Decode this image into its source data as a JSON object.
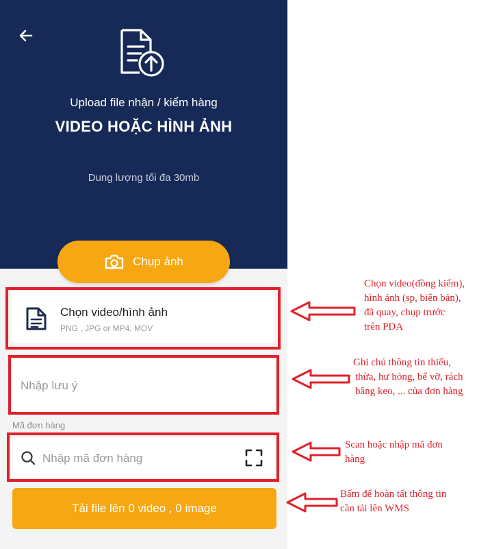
{
  "header": {
    "subtitle": "Upload file nhận / kiểm hàng",
    "title": "VIDEO HOẶC HÌNH ẢNH",
    "size_note": "Dung lượng tối đa 30mb",
    "background_color": "#172a57"
  },
  "camera_button": {
    "label": "Chụp ảnh",
    "icon": "camera-icon"
  },
  "file_picker": {
    "label": "Chọn video/hình ảnh",
    "hint": "PNG , JPG or MP4, MOV",
    "icon": "document-icon"
  },
  "note_field": {
    "placeholder": "Nhập lưu ý",
    "value": ""
  },
  "order_code": {
    "label": "Mã đơn hàng",
    "placeholder": "Nhập mã đơn hàng",
    "value": "",
    "search_icon": "search-icon",
    "scan_icon": "scan-icon"
  },
  "submit_button": {
    "label": "Tải file lên 0 video , 0 image"
  },
  "annotations": {
    "file_picker": [
      "Chọn video(đồng kiểm),",
      "hình ảnh (sp, biên bản),",
      "đã quay, chụp trước",
      "trên PDA"
    ],
    "note": [
      "Ghi chú thông tin thiếu,",
      "thừa, hư hỏng, bể vỡ, rách",
      "băng keo, ... của đơn hàng"
    ],
    "order": [
      "Scan hoặc nhập mã đơn",
      "hàng"
    ],
    "submit": [
      "Bấm để hoàn tất thông tin",
      "cần tải lên WMS"
    ]
  },
  "colors": {
    "accent": "#f7a711",
    "annotation_red": "#e0212b",
    "panel_bg": "#f4f4f4"
  }
}
